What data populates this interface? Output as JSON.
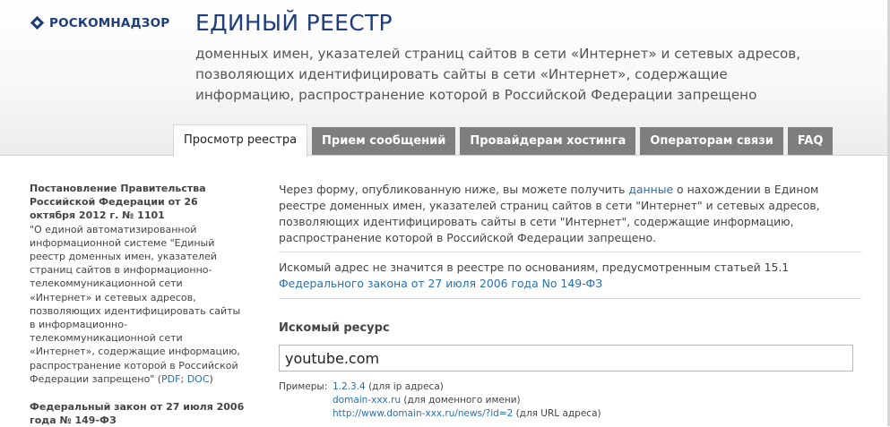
{
  "header": {
    "logo_text": "РОСКОМНАДЗОР",
    "title": "ЕДИНЫЙ РЕЕСТР",
    "subtitle": "доменных имен, указателей страниц сайтов в сети «Интернет» и сетевых адресов, позволяющих идентифицировать сайты в сети «Интернет», содержащие информацию, распространение которой в Российской Федерации запрещено"
  },
  "tabs": [
    {
      "label": "Просмотр реестра",
      "active": true
    },
    {
      "label": "Прием сообщений",
      "active": false
    },
    {
      "label": "Провайдерам хостинга",
      "active": false
    },
    {
      "label": "Операторам связи",
      "active": false
    },
    {
      "label": "FAQ",
      "active": false
    }
  ],
  "sidebar": {
    "decree_title": "Постановление Правительства Российской Федерации от 26 октября 2012 г. № 1101",
    "decree_text": "\"О единой автоматизированной информационной системе \"Единый реестр доменных имен, указателей страниц сайтов в информационно-телекоммуникационной сети «Интернет» и сетевых адресов, позволяющих идентифицировать сайты в информационно-телекоммуникационной сети «Интернет», содержащие информацию, распространение которой в Российской Федерации запрещено\" (",
    "pdf_link": "PDF",
    "separator": "; ",
    "doc_link": "DOC",
    "close_paren": ")",
    "law_title": "Федеральный закон от 27 июля 2006 года № 149-ФЗ"
  },
  "main": {
    "intro_before": "Через форму, опубликованную ниже, вы можете получить ",
    "intro_link": "данные",
    "intro_after": " о нахождении в Едином реестре доменных имен, указателей страниц сайтов в сети \"Интернет\" и сетевых адресов, позволяющих идентифицировать сайты в сети \"Интернет\", содержащие информацию, распространение которой в Российской Федерации запрещено.",
    "status_before": "Искомый адрес не значится в реестре по основаниям, предусмотренным статьей 15.1 ",
    "status_link": "Федерального закона от 27 июля 2006 года No 149-ФЗ",
    "resource_label": "Искомый ресурс",
    "resource_value": "youtube.com",
    "examples_label": "Примеры:",
    "examples": [
      {
        "link": "1.2.3.4",
        "note": " (для ip адреса)"
      },
      {
        "link": "domain-xxx.ru",
        "note": " (для доменного имени)"
      },
      {
        "link": "http://www.domain-xxx.ru/news/?id=2",
        "note": " (для URL адреса)"
      }
    ]
  },
  "colors": {
    "brand_blue": "#1e3e7c",
    "link_blue": "#2a6fb0",
    "tab_gray": "#7e7e7e"
  }
}
